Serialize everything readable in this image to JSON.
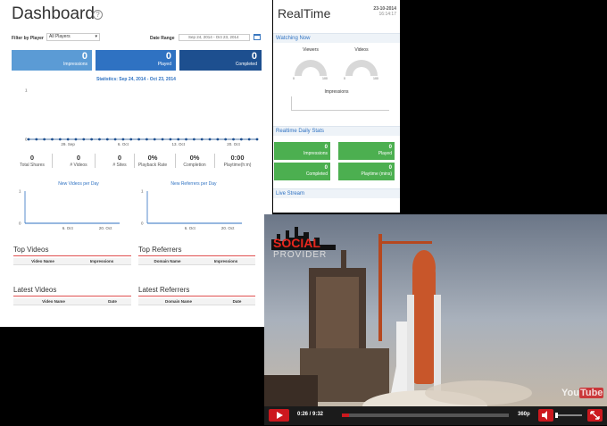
{
  "dashboard": {
    "title": "Dashboard",
    "help": "?",
    "filter_label": "Filter by Player",
    "filter_value": "All Players",
    "date_range_label": "Date Range",
    "date_range_value": "Sep 24, 2014 - Oct 23, 2014",
    "stat_boxes": [
      {
        "value": "0",
        "label": "Impressions"
      },
      {
        "value": "0",
        "label": "Played"
      },
      {
        "value": "0",
        "label": "Completed"
      }
    ],
    "statistics_label": "Statistics: Sep 24, 2014 - Oct 23, 2014",
    "metrics": [
      {
        "value": "0",
        "label": "Total Shares"
      },
      {
        "value": "0",
        "label": "# Videos"
      },
      {
        "value": "0",
        "label": "# Sites"
      },
      {
        "value": "0%",
        "label": "Playback Rate"
      },
      {
        "value": "0%",
        "label": "Completion"
      },
      {
        "value": "0:00",
        "label": "Playtime(h:m)"
      }
    ],
    "new_videos_title": "New Videos per Day",
    "new_referrers_title": "New Referrers per Day",
    "top_videos": {
      "title": "Top Videos",
      "cols": [
        "Video Name",
        "Impressions"
      ]
    },
    "top_referrers": {
      "title": "Top Referrers",
      "cols": [
        "Domain Name",
        "Impressions"
      ]
    },
    "latest_videos": {
      "title": "Latest Videos",
      "cols": [
        "Video Name",
        "Date"
      ]
    },
    "latest_referrers": {
      "title": "Latest Referrers",
      "cols": [
        "Domain Name",
        "Date"
      ]
    }
  },
  "chart_data": [
    {
      "type": "line",
      "title": "Statistics: Sep 24, 2014 - Oct 23, 2014",
      "x_ticks": [
        "29. Sep",
        "6. Oct",
        "13. Oct",
        "20. Oct"
      ],
      "y_ticks": [
        "0",
        "1"
      ],
      "ylim": [
        0,
        1
      ],
      "series": [
        {
          "values": [
            0,
            0,
            0,
            0,
            0,
            0,
            0,
            0,
            0,
            0,
            0,
            0,
            0,
            0,
            0,
            0,
            0,
            0,
            0,
            0,
            0,
            0,
            0,
            0,
            0,
            0,
            0,
            0,
            0,
            0
          ]
        }
      ],
      "marker": "dot",
      "color": "#1d4f8f"
    },
    {
      "type": "line",
      "title": "New Videos per Day",
      "x_ticks": [
        "6. Oct",
        "20. Oct"
      ],
      "y_ticks": [
        "0",
        "1"
      ],
      "ylim": [
        0,
        1
      ],
      "series": [
        {
          "values": [
            0,
            0
          ]
        }
      ],
      "color": "#2f72c2"
    },
    {
      "type": "line",
      "title": "New Referrers per Day",
      "x_ticks": [
        "6. Oct",
        "20. Oct"
      ],
      "y_ticks": [
        "0",
        "1"
      ],
      "ylim": [
        0,
        1
      ],
      "series": [
        {
          "values": [
            0,
            0
          ]
        }
      ],
      "color": "#2f72c2"
    }
  ],
  "realtime": {
    "title": "RealTime",
    "date": "23-10-2014",
    "time": "16:14:17",
    "watching_now": "Watching Now",
    "gauges": [
      {
        "label": "Viewers",
        "min": "0",
        "max": "100",
        "value": 0
      },
      {
        "label": "Videos",
        "min": "0",
        "max": "100",
        "value": 0
      }
    ],
    "impressions_label": "Impressions",
    "daily_stats": "Realtime Daily Stats",
    "daily_boxes": [
      {
        "value": "0",
        "label": "Impressions"
      },
      {
        "value": "0",
        "label": "Played"
      },
      {
        "value": "0",
        "label": "Completed"
      },
      {
        "value": "0",
        "label": "Playtime (mins)"
      }
    ],
    "live_stream": "Live Stream"
  },
  "video": {
    "brand_top": "SOCIAL",
    "brand_bottom": "PROVIDER",
    "elapsed": "0:26",
    "duration": "9:32",
    "time_display": "0:26 / 9:32",
    "quality": "360p",
    "progress_fraction": 0.045,
    "youtube_logo": "You Tube",
    "colors": {
      "accent": "#cc181e"
    }
  }
}
